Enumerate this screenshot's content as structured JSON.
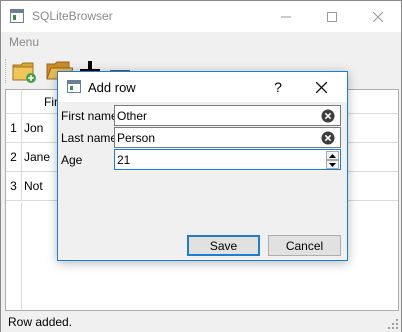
{
  "window": {
    "title": "SQLiteBrowser"
  },
  "menu": {
    "items": [
      {
        "label": "Menu"
      }
    ]
  },
  "toolbar": {
    "buttons": [
      {
        "icon": "new-database-icon"
      },
      {
        "icon": "open-folder-icon"
      },
      {
        "icon": "add-row-icon"
      },
      {
        "icon": "delete-row-icon"
      }
    ]
  },
  "table": {
    "columns": [
      "First name"
    ],
    "rows": [
      {
        "row_number": "1",
        "first_name": "Jon"
      },
      {
        "row_number": "2",
        "first_name": "Jane"
      },
      {
        "row_number": "3",
        "first_name": "Not"
      }
    ]
  },
  "status": {
    "text": "Row added."
  },
  "dialog": {
    "title": "Add row",
    "help_label": "?",
    "fields": {
      "first_name": {
        "label": "First name",
        "value": "Other"
      },
      "last_name": {
        "label": "Last name",
        "value": "Person"
      },
      "age": {
        "label": "Age",
        "value": "21"
      }
    },
    "buttons": {
      "save": "Save",
      "cancel": "Cancel"
    },
    "accent_color": "#1a7fd1"
  }
}
